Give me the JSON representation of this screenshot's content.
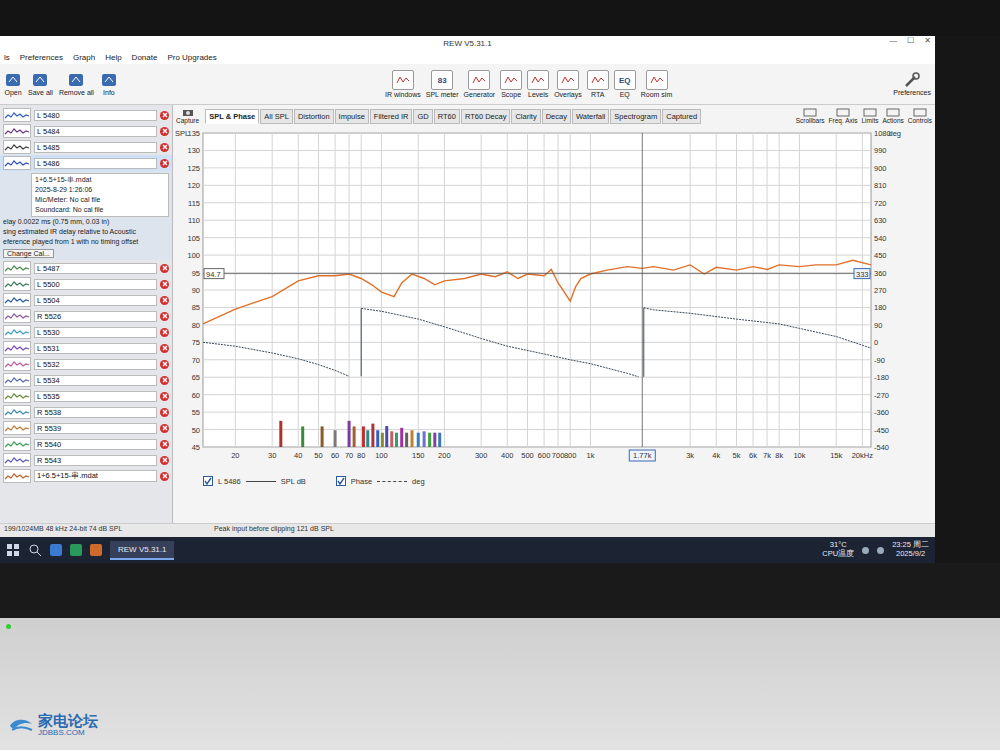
{
  "window": {
    "title": "REW V5.31.1",
    "controls": [
      "—",
      "☐",
      "✕"
    ]
  },
  "menu": [
    "ls",
    "Preferences",
    "Graph",
    "Help",
    "Donate",
    "Pro Upgrades"
  ],
  "file_tools": [
    "Open",
    "Save all",
    "Remove all",
    "Info"
  ],
  "tools": [
    {
      "label": "IR windows",
      "badge": ""
    },
    {
      "label": "SPL meter",
      "badge": "83"
    },
    {
      "label": "Generator",
      "badge": ""
    },
    {
      "label": "Scope",
      "badge": ""
    },
    {
      "label": "Levels",
      "badge": ""
    },
    {
      "label": "Overlays",
      "badge": ""
    },
    {
      "label": "RTA",
      "badge": ""
    },
    {
      "label": "EQ",
      "badge": "EQ"
    },
    {
      "label": "Room sim",
      "badge": ""
    }
  ],
  "preferences": "Preferences",
  "view_tools": [
    "Scrollbars",
    "Freq. Axis",
    "Limits",
    "Actions",
    "Controls"
  ],
  "capture": "Capture",
  "tabs": [
    {
      "label": "SPL & Phase",
      "selected": true
    },
    {
      "label": "All SPL",
      "selected": false
    },
    {
      "label": "Distortion",
      "selected": false
    },
    {
      "label": "Impulse",
      "selected": false
    },
    {
      "label": "Filtered IR",
      "selected": false
    },
    {
      "label": "GD",
      "selected": false
    },
    {
      "label": "RT60",
      "selected": false
    },
    {
      "label": "RT60 Decay",
      "selected": false
    },
    {
      "label": "Clarity",
      "selected": false
    },
    {
      "label": "Decay",
      "selected": false
    },
    {
      "label": "Waterfall",
      "selected": false
    },
    {
      "label": "Spectrogram",
      "selected": false
    },
    {
      "label": "Captured",
      "selected": false
    }
  ],
  "measurements": [
    {
      "name": "L 5480",
      "color": "#3060c0",
      "selected": false
    },
    {
      "name": "L 5484",
      "color": "#6a3a8a",
      "selected": false
    },
    {
      "name": "L 5485",
      "color": "#404040",
      "selected": false
    },
    {
      "name": "L 5486",
      "color": "#3050c0",
      "selected": true
    },
    {
      "name": "L 5487",
      "color": "#4a8a4a",
      "selected": false
    },
    {
      "name": "L 5500",
      "color": "#3a7a5a",
      "selected": false
    },
    {
      "name": "L 5504",
      "color": "#2a5aa0",
      "selected": false
    },
    {
      "name": "R 5526",
      "color": "#8a5a9a",
      "selected": false
    },
    {
      "name": "L 5530",
      "color": "#3aa0c0",
      "selected": false
    },
    {
      "name": "L 5531",
      "color": "#7a4ac0",
      "selected": false
    },
    {
      "name": "L 5532",
      "color": "#c05a9a",
      "selected": false
    },
    {
      "name": "L 5534",
      "color": "#5a6ab0",
      "selected": false
    },
    {
      "name": "L 5535",
      "color": "#6a8a3a",
      "selected": false
    },
    {
      "name": "R 5538",
      "color": "#3a8ab0",
      "selected": false
    },
    {
      "name": "R 5539",
      "color": "#c07a3a",
      "selected": false
    },
    {
      "name": "R 5540",
      "color": "#3aa05a",
      "selected": false
    },
    {
      "name": "R 5543",
      "color": "#5a5ac0",
      "selected": false
    },
    {
      "name": "1+6.5+15-串.mdat",
      "color": "#c0602a",
      "selected": false
    }
  ],
  "selected_details": {
    "file": "1+6.5+15-串.mdat",
    "date": "2025-8-29 1:26:06",
    "mic": "Mic/Meter: No cal file",
    "soundcard": "Soundcard: No cal file",
    "notes": [
      "elay 0.0022 ms (0.75 mm, 0.03 in)",
      "sing estimated IR delay relative to Acoustic",
      "eference played from 1 with no timing offset"
    ],
    "change_cal": "Change Cal..."
  },
  "chart": {
    "left_title": "SPL",
    "right_title": "deg",
    "left_labels": [
      "135",
      "130",
      "125",
      "120",
      "115",
      "110",
      "105",
      "100",
      "95",
      "90",
      "85",
      "80",
      "75",
      "70",
      "65",
      "60",
      "55",
      "50",
      "45"
    ],
    "right_labels": [
      "1080",
      "990",
      "900",
      "810",
      "720",
      "630",
      "540",
      "450",
      "360",
      "270",
      "180",
      "90",
      "0",
      "-90",
      "-180",
      "-270",
      "-360",
      "-450",
      "-540"
    ],
    "spl_range": [
      45,
      135
    ],
    "phase_range": [
      -540,
      1080
    ],
    "x_range": [
      14,
      22000
    ],
    "x_ticks": [
      {
        "label": "20",
        "freq": 20
      },
      {
        "label": "30",
        "freq": 30
      },
      {
        "label": "40",
        "freq": 40
      },
      {
        "label": "50",
        "freq": 50
      },
      {
        "label": "60",
        "freq": 60
      },
      {
        "label": "70",
        "freq": 70
      },
      {
        "label": "80",
        "freq": 80
      },
      {
        "label": "100",
        "freq": 100
      },
      {
        "label": "150",
        "freq": 150
      },
      {
        "label": "200",
        "freq": 200
      },
      {
        "label": "300",
        "freq": 300
      },
      {
        "label": "400",
        "freq": 400
      },
      {
        "label": "500",
        "freq": 500
      },
      {
        "label": "600",
        "freq": 600
      },
      {
        "label": "700",
        "freq": 700
      },
      {
        "label": "800",
        "freq": 800
      },
      {
        "label": "1k",
        "freq": 1000
      },
      {
        "label": "3k",
        "freq": 3000
      },
      {
        "label": "4k",
        "freq": 4000
      },
      {
        "label": "5k",
        "freq": 5000
      },
      {
        "label": "6k",
        "freq": 6000
      },
      {
        "label": "7k",
        "freq": 7000
      },
      {
        "label": "8k",
        "freq": 8000
      },
      {
        "label": "10k",
        "freq": 10000
      },
      {
        "label": "15k",
        "freq": 15000
      },
      {
        "label": "20kHz",
        "freq": 20000
      }
    ],
    "spl": {
      "color": "#e0702a",
      "freqs": [
        14,
        20,
        25,
        30,
        40,
        50,
        60,
        70,
        80,
        90,
        100,
        115,
        125,
        140,
        160,
        180,
        200,
        250,
        300,
        350,
        400,
        450,
        500,
        600,
        650,
        700,
        750,
        800,
        850,
        900,
        1000,
        1200,
        1500,
        1770,
        2000,
        2500,
        3000,
        3500,
        4000,
        5000,
        6000,
        7000,
        8000,
        10000,
        12000,
        15000,
        18000,
        22000
      ],
      "values": [
        80.3,
        84.5,
        86.5,
        88.1,
        92.6,
        94.1,
        94.1,
        94.6,
        93.3,
        91.5,
        89.4,
        88.1,
        92.0,
        94.6,
        93.3,
        91.5,
        92.6,
        93.3,
        94.6,
        93.8,
        95.2,
        93.3,
        94.6,
        94.1,
        95.9,
        92.0,
        89.4,
        86.8,
        91.0,
        93.3,
        94.6,
        95.7,
        96.7,
        96.2,
        96.7,
        95.7,
        97.2,
        94.6,
        96.5,
        95.7,
        96.7,
        95.9,
        97.2,
        96.7,
        97.2,
        97.2,
        98.5,
        97.2
      ]
    },
    "phase": {
      "color": "#3a4a5a",
      "freqs": [
        14,
        20,
        30,
        40,
        50,
        60,
        70,
        80,
        100,
        150,
        200,
        300,
        400,
        600,
        800,
        1000,
        1500,
        1700,
        1800,
        2000,
        3000,
        5000,
        8000,
        10000,
        15000,
        20000,
        22000
      ],
      "values": [
        0,
        -20,
        -55,
        -85,
        -115,
        -145,
        -175,
        175,
        160,
        120,
        80,
        20,
        -20,
        -60,
        -90,
        -110,
        -160,
        -178,
        178,
        168,
        150,
        120,
        95,
        72,
        30,
        -15,
        -30
      ]
    },
    "rta_bars": [
      {
        "freq": 33,
        "value": 52.5,
        "color": "#b03030"
      },
      {
        "freq": 42,
        "value": 50.9,
        "color": "#3a8a3a"
      },
      {
        "freq": 52,
        "value": 50.9,
        "color": "#8a5a2a"
      },
      {
        "freq": 60,
        "value": 49.8,
        "color": "#7a7a7a"
      },
      {
        "freq": 70,
        "value": 52.5,
        "color": "#7a3aa0"
      },
      {
        "freq": 74,
        "value": 50.9,
        "color": "#a06030"
      },
      {
        "freq": 82,
        "value": 50.9,
        "color": "#c03030"
      },
      {
        "freq": 86,
        "value": 49.8,
        "color": "#2a8a8a"
      },
      {
        "freq": 91,
        "value": 51.7,
        "color": "#b03040"
      },
      {
        "freq": 96,
        "value": 49.8,
        "color": "#3060c0"
      },
      {
        "freq": 101,
        "value": 49.1,
        "color": "#8a8a2a"
      },
      {
        "freq": 106,
        "value": 51.0,
        "color": "#4a4ab0"
      },
      {
        "freq": 112,
        "value": 49.5,
        "color": "#c06060"
      },
      {
        "freq": 118,
        "value": 49.1,
        "color": "#30a070"
      },
      {
        "freq": 125,
        "value": 50.5,
        "color": "#a030a0"
      },
      {
        "freq": 132,
        "value": 49.1,
        "color": "#606060"
      },
      {
        "freq": 140,
        "value": 49.8,
        "color": "#c08030"
      },
      {
        "freq": 150,
        "value": 49.1,
        "color": "#3080c0"
      },
      {
        "freq": 160,
        "value": 49.5,
        "color": "#7070d0"
      },
      {
        "freq": 170,
        "value": 49.1,
        "color": "#40a040"
      },
      {
        "freq": 180,
        "value": 49.1,
        "color": "#8040a0"
      },
      {
        "freq": 190,
        "value": 49.1,
        "color": "#3a7ab0"
      }
    ],
    "cursor": {
      "freq": 1770,
      "spl": 94.7,
      "freq_label": "1.77k",
      "spl_label": "94.7",
      "phase_label": "333"
    }
  },
  "legend": [
    {
      "label": "L 5486",
      "unit": "SPL dB",
      "checked": true,
      "kind": "solid"
    },
    {
      "label": "Phase",
      "unit": "deg",
      "checked": true,
      "kind": "dashed"
    }
  ],
  "status_bar": {
    "left": "199/1024MB  48 kHz  24-bit  74 dB SPL",
    "peak": "Peak input before clipping 121 dB SPL"
  },
  "taskbar": {
    "app": "REW V5.31.1",
    "temp": "31°C",
    "temp_label": "CPU温度",
    "time": "23:25 周二",
    "date": "2025/9/2"
  },
  "watermark": {
    "name": "家电论坛",
    "site": "JDBBS.COM"
  }
}
